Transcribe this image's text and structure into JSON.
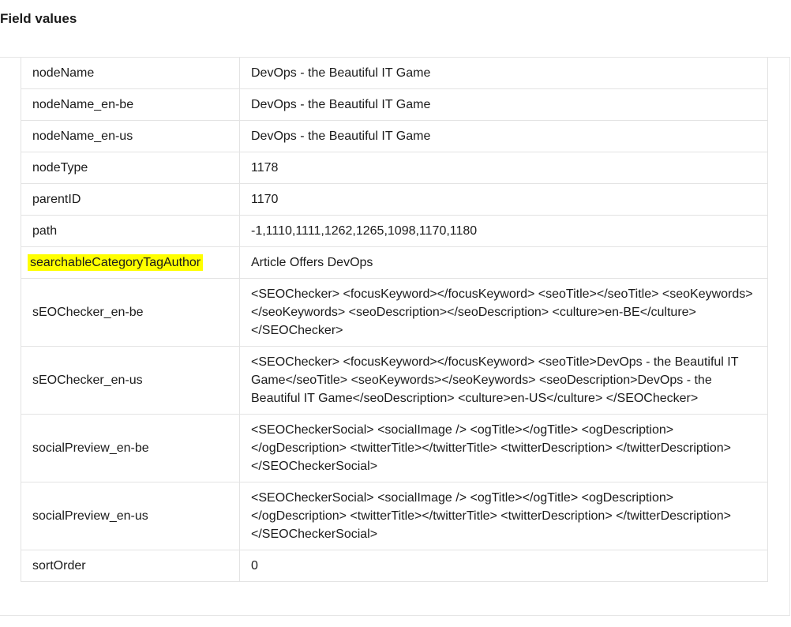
{
  "section": {
    "title": "Field values"
  },
  "fields": [
    {
      "key": "nodeName",
      "value": "DevOps - the Beautiful IT Game"
    },
    {
      "key": "nodeName_en-be",
      "value": "DevOps - the Beautiful IT Game"
    },
    {
      "key": "nodeName_en-us",
      "value": "DevOps - the Beautiful IT Game"
    },
    {
      "key": "nodeType",
      "value": "1178"
    },
    {
      "key": "parentID",
      "value": "1170"
    },
    {
      "key": "path",
      "value": "-1,1110,1111,1262,1265,1098,1170,1180"
    },
    {
      "key": "searchableCategoryTagAuthor",
      "value": "Article Offers DevOps",
      "highlighted": true,
      "highlight_color": "#ffff00"
    },
    {
      "key": "sEOChecker_en-be",
      "value": "<SEOChecker> <focusKeyword></focusKeyword> <seoTitle></seoTitle> <seoKeywords></seoKeywords> <seoDescription></seoDescription> <culture>en-BE</culture> </SEOChecker>"
    },
    {
      "key": "sEOChecker_en-us",
      "value": "<SEOChecker> <focusKeyword></focusKeyword> <seoTitle>DevOps - the Beautiful IT Game</seoTitle> <seoKeywords></seoKeywords> <seoDescription>DevOps - the Beautiful IT Game</seoDescription> <culture>en-US</culture> </SEOChecker>"
    },
    {
      "key": "socialPreview_en-be",
      "value": "<SEOCheckerSocial> <socialImage /> <ogTitle></ogTitle> <ogDescription> </ogDescription> <twitterTitle></twitterTitle> <twitterDescription> </twitterDescription> </SEOCheckerSocial>"
    },
    {
      "key": "socialPreview_en-us",
      "value": "<SEOCheckerSocial> <socialImage /> <ogTitle></ogTitle> <ogDescription> </ogDescription> <twitterTitle></twitterTitle> <twitterDescription> </twitterDescription> </SEOCheckerSocial>"
    },
    {
      "key": "sortOrder",
      "value": "0"
    }
  ]
}
